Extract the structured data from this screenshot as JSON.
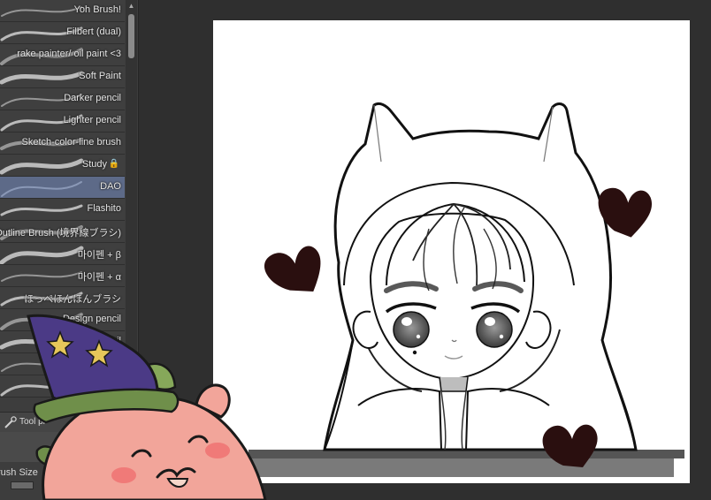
{
  "brush_panel": {
    "items": [
      {
        "name": "Yoh Brush!",
        "locked": false,
        "selected": false
      },
      {
        "name": "Filbert (dual)",
        "locked": false,
        "selected": false
      },
      {
        "name": "rake painter/ oil paint <3",
        "locked": false,
        "selected": false
      },
      {
        "name": "Soft Paint",
        "locked": false,
        "selected": false
      },
      {
        "name": "Darker pencil",
        "locked": false,
        "selected": false
      },
      {
        "name": "Lighter pencil",
        "locked": false,
        "selected": false
      },
      {
        "name": "Sketch-color-line brush",
        "locked": false,
        "selected": false
      },
      {
        "name": "Study",
        "locked": true,
        "selected": false
      },
      {
        "name": "DAO",
        "locked": false,
        "selected": true
      },
      {
        "name": "Flashito",
        "locked": false,
        "selected": false
      },
      {
        "name": "Outline Brush (境界線ブラシ)",
        "locked": false,
        "selected": false
      },
      {
        "name": "마이펜 + β",
        "locked": false,
        "selected": false
      },
      {
        "name": "마이펜 + α",
        "locked": false,
        "selected": false
      },
      {
        "name": "ほっぺほんほんブラシ",
        "locked": false,
        "selected": false
      },
      {
        "name": "Design pencil",
        "locked": false,
        "selected": false
      },
      {
        "name": "al pencil",
        "locked": false,
        "selected": false
      },
      {
        "name": "",
        "locked": false,
        "selected": false
      },
      {
        "name": "",
        "locked": false,
        "selected": false
      }
    ],
    "tool_property_label": "Tool pr",
    "brush_size_label": "rush Size"
  },
  "icons": {
    "lock": "lock-icon",
    "scroll_up": "chevron-up-icon",
    "tool_property": "brush-settings-icon"
  },
  "colors": {
    "panel_bg": "#3d3d3d",
    "selected_row": "#5d6a88",
    "workspace_bg": "#2f2f2f",
    "heart": "#2a0f0f"
  }
}
